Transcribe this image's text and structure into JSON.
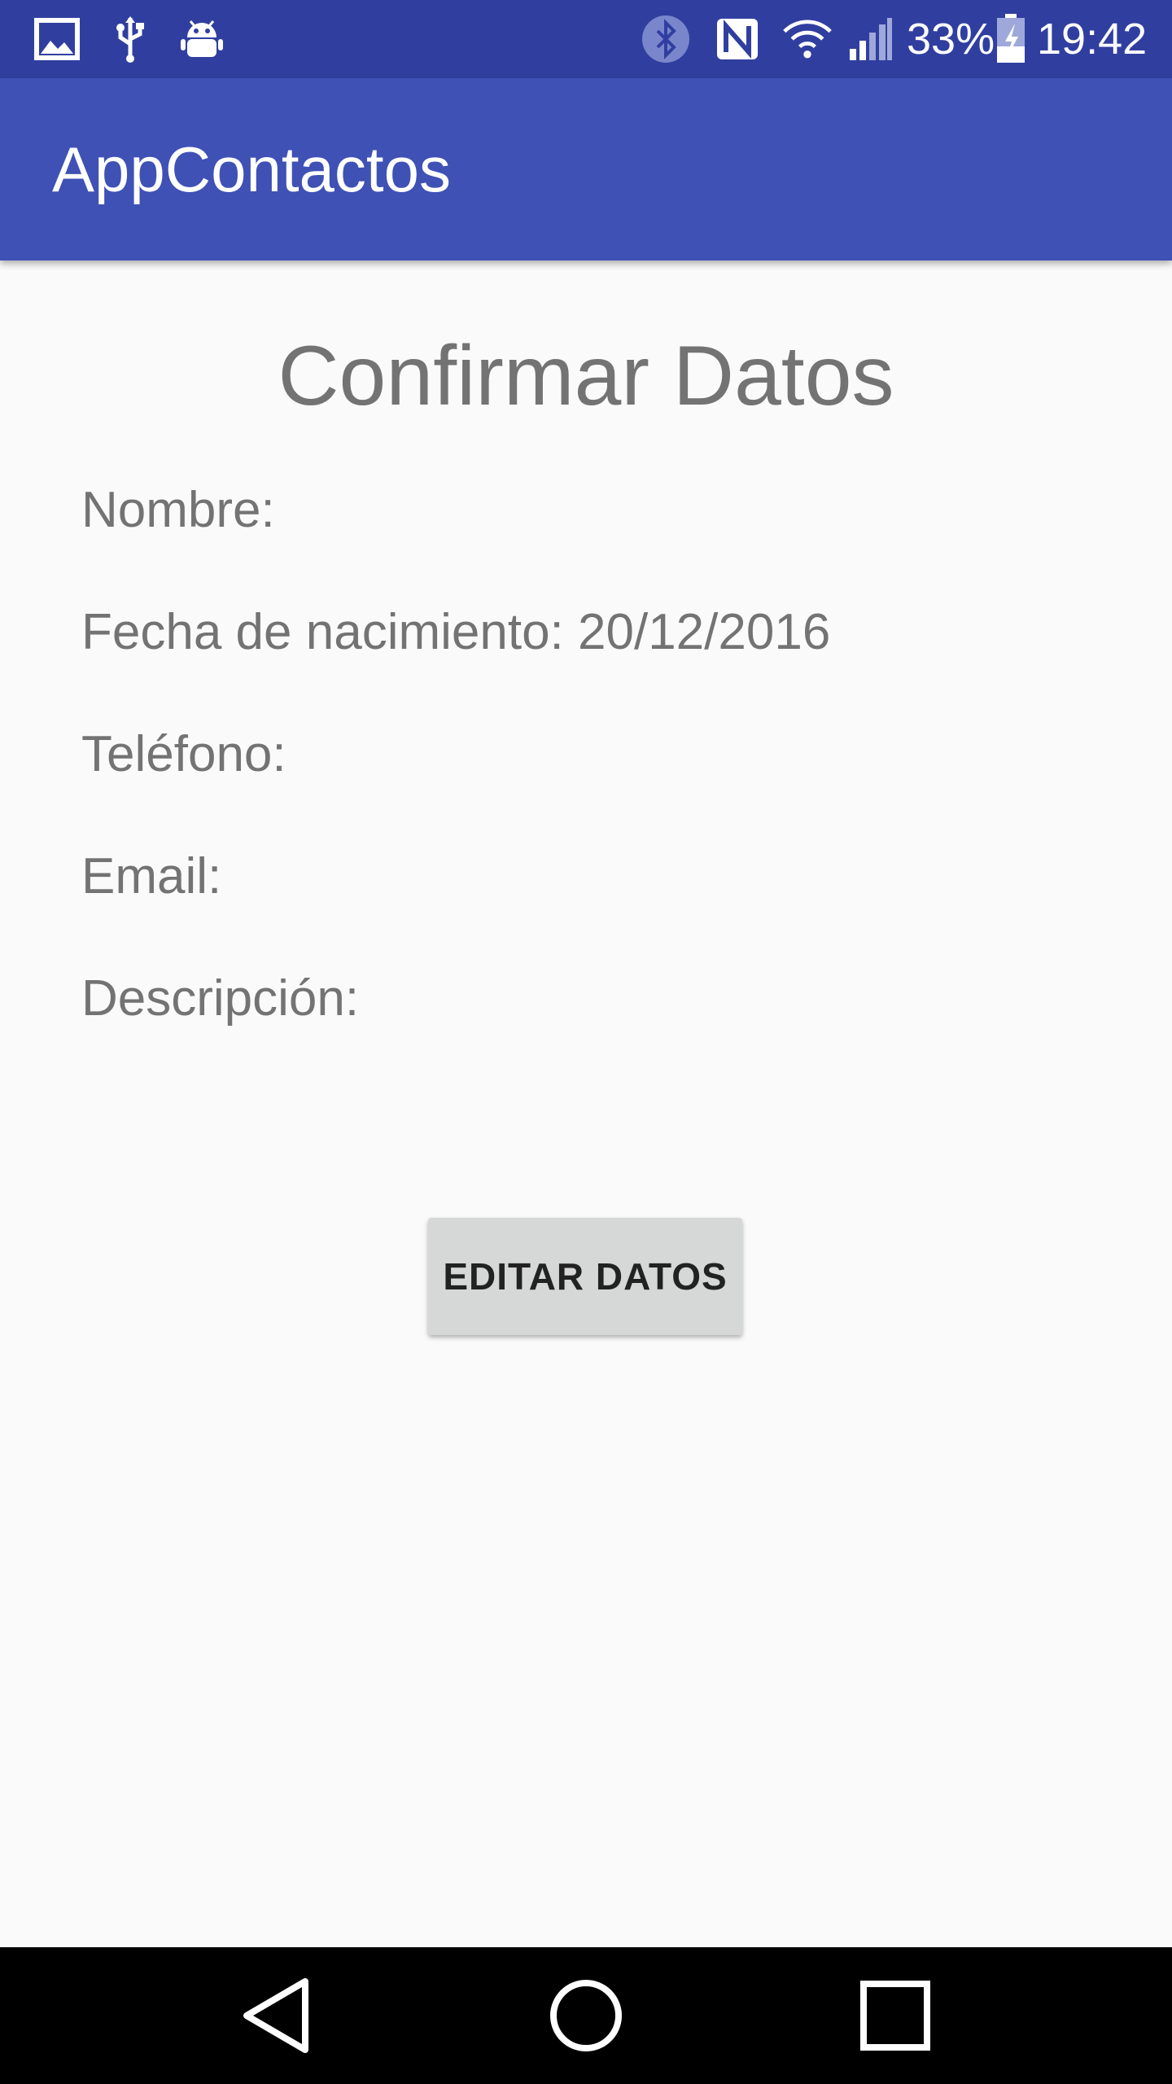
{
  "status_bar": {
    "battery_percent": "33%",
    "time": "19:42",
    "left_icons": [
      "image-icon",
      "usb-icon",
      "android-debug-icon"
    ],
    "right_icons": [
      "bluetooth-icon",
      "nfc-icon",
      "wifi-icon",
      "signal-icon",
      "battery-charging-icon"
    ]
  },
  "app_bar": {
    "title": "AppContactos"
  },
  "main": {
    "title": "Confirmar Datos",
    "fields": {
      "nombre": "Nombre:",
      "fecha_nacimiento": "Fecha de nacimiento: 20/12/2016",
      "telefono": "Teléfono:",
      "email": "Email:",
      "descripcion": "Descripción:"
    },
    "edit_button_label": "EDITAR DATOS"
  },
  "nav_bar": {
    "icons": [
      "back-icon",
      "home-icon",
      "recents-icon"
    ]
  },
  "colors": {
    "status_bar": "#303f9f",
    "app_bar": "#3f51b5",
    "background": "#fafafa",
    "text": "#737373",
    "button": "#d6d7d7"
  }
}
